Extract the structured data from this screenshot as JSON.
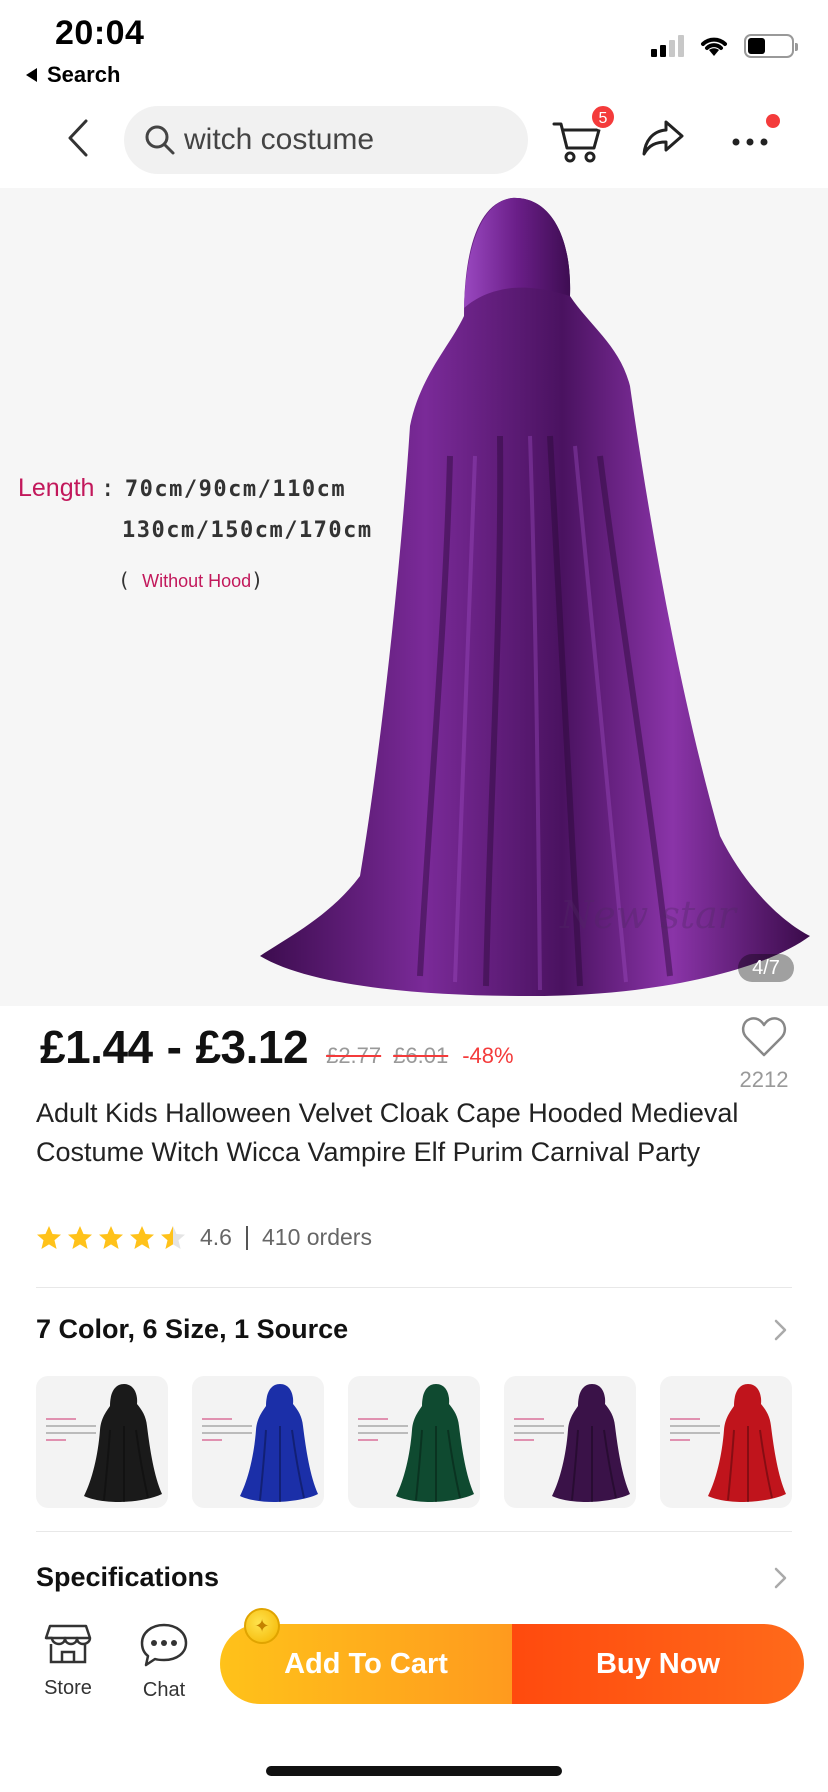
{
  "status_bar": {
    "time": "20:04",
    "back_app_label": "Search"
  },
  "top_nav": {
    "search_query": "witch costume",
    "cart_count": "5"
  },
  "gallery": {
    "length_label": "Length",
    "length_colon": ":",
    "length_line1": "70cm/90cm/110cm",
    "length_line2": "130cm/150cm/170cm",
    "length_open": "(",
    "length_hood": "Without Hood",
    "length_close": ")",
    "watermark": "New star",
    "counter": "4/7"
  },
  "product": {
    "price_low": "£1.44",
    "price_dash": "-",
    "price_high": "£3.12",
    "old_price_low": "£2.77",
    "old_price_high": "£6.01",
    "discount": "-48%",
    "wishlist_count": "2212",
    "title": "Adult Kids Halloween Velvet Cloak Cape Hooded Medieval Costume Witch Wicca Vampire Elf Purim Carnival Party",
    "rating": "4.6",
    "rating_stars": 4.5,
    "orders": "410 orders"
  },
  "variants": {
    "heading": "7 Color, 6 Size, 1 Source",
    "swatch_colors": [
      "#1a1a1a",
      "#1b2fa8",
      "#0f4a30",
      "#3a1248",
      "#c0141c"
    ]
  },
  "specifications": {
    "heading": "Specifications"
  },
  "bottom_bar": {
    "store_label": "Store",
    "chat_label": "Chat",
    "add_to_cart": "Add To Cart",
    "buy_now": "Buy Now"
  },
  "colors": {
    "accent_red": "#f43b3b",
    "cart_gradient_start": "#ffc21a",
    "buy_gradient_start": "#ff4a0e",
    "cloak_purple": "#5a1a6e"
  }
}
